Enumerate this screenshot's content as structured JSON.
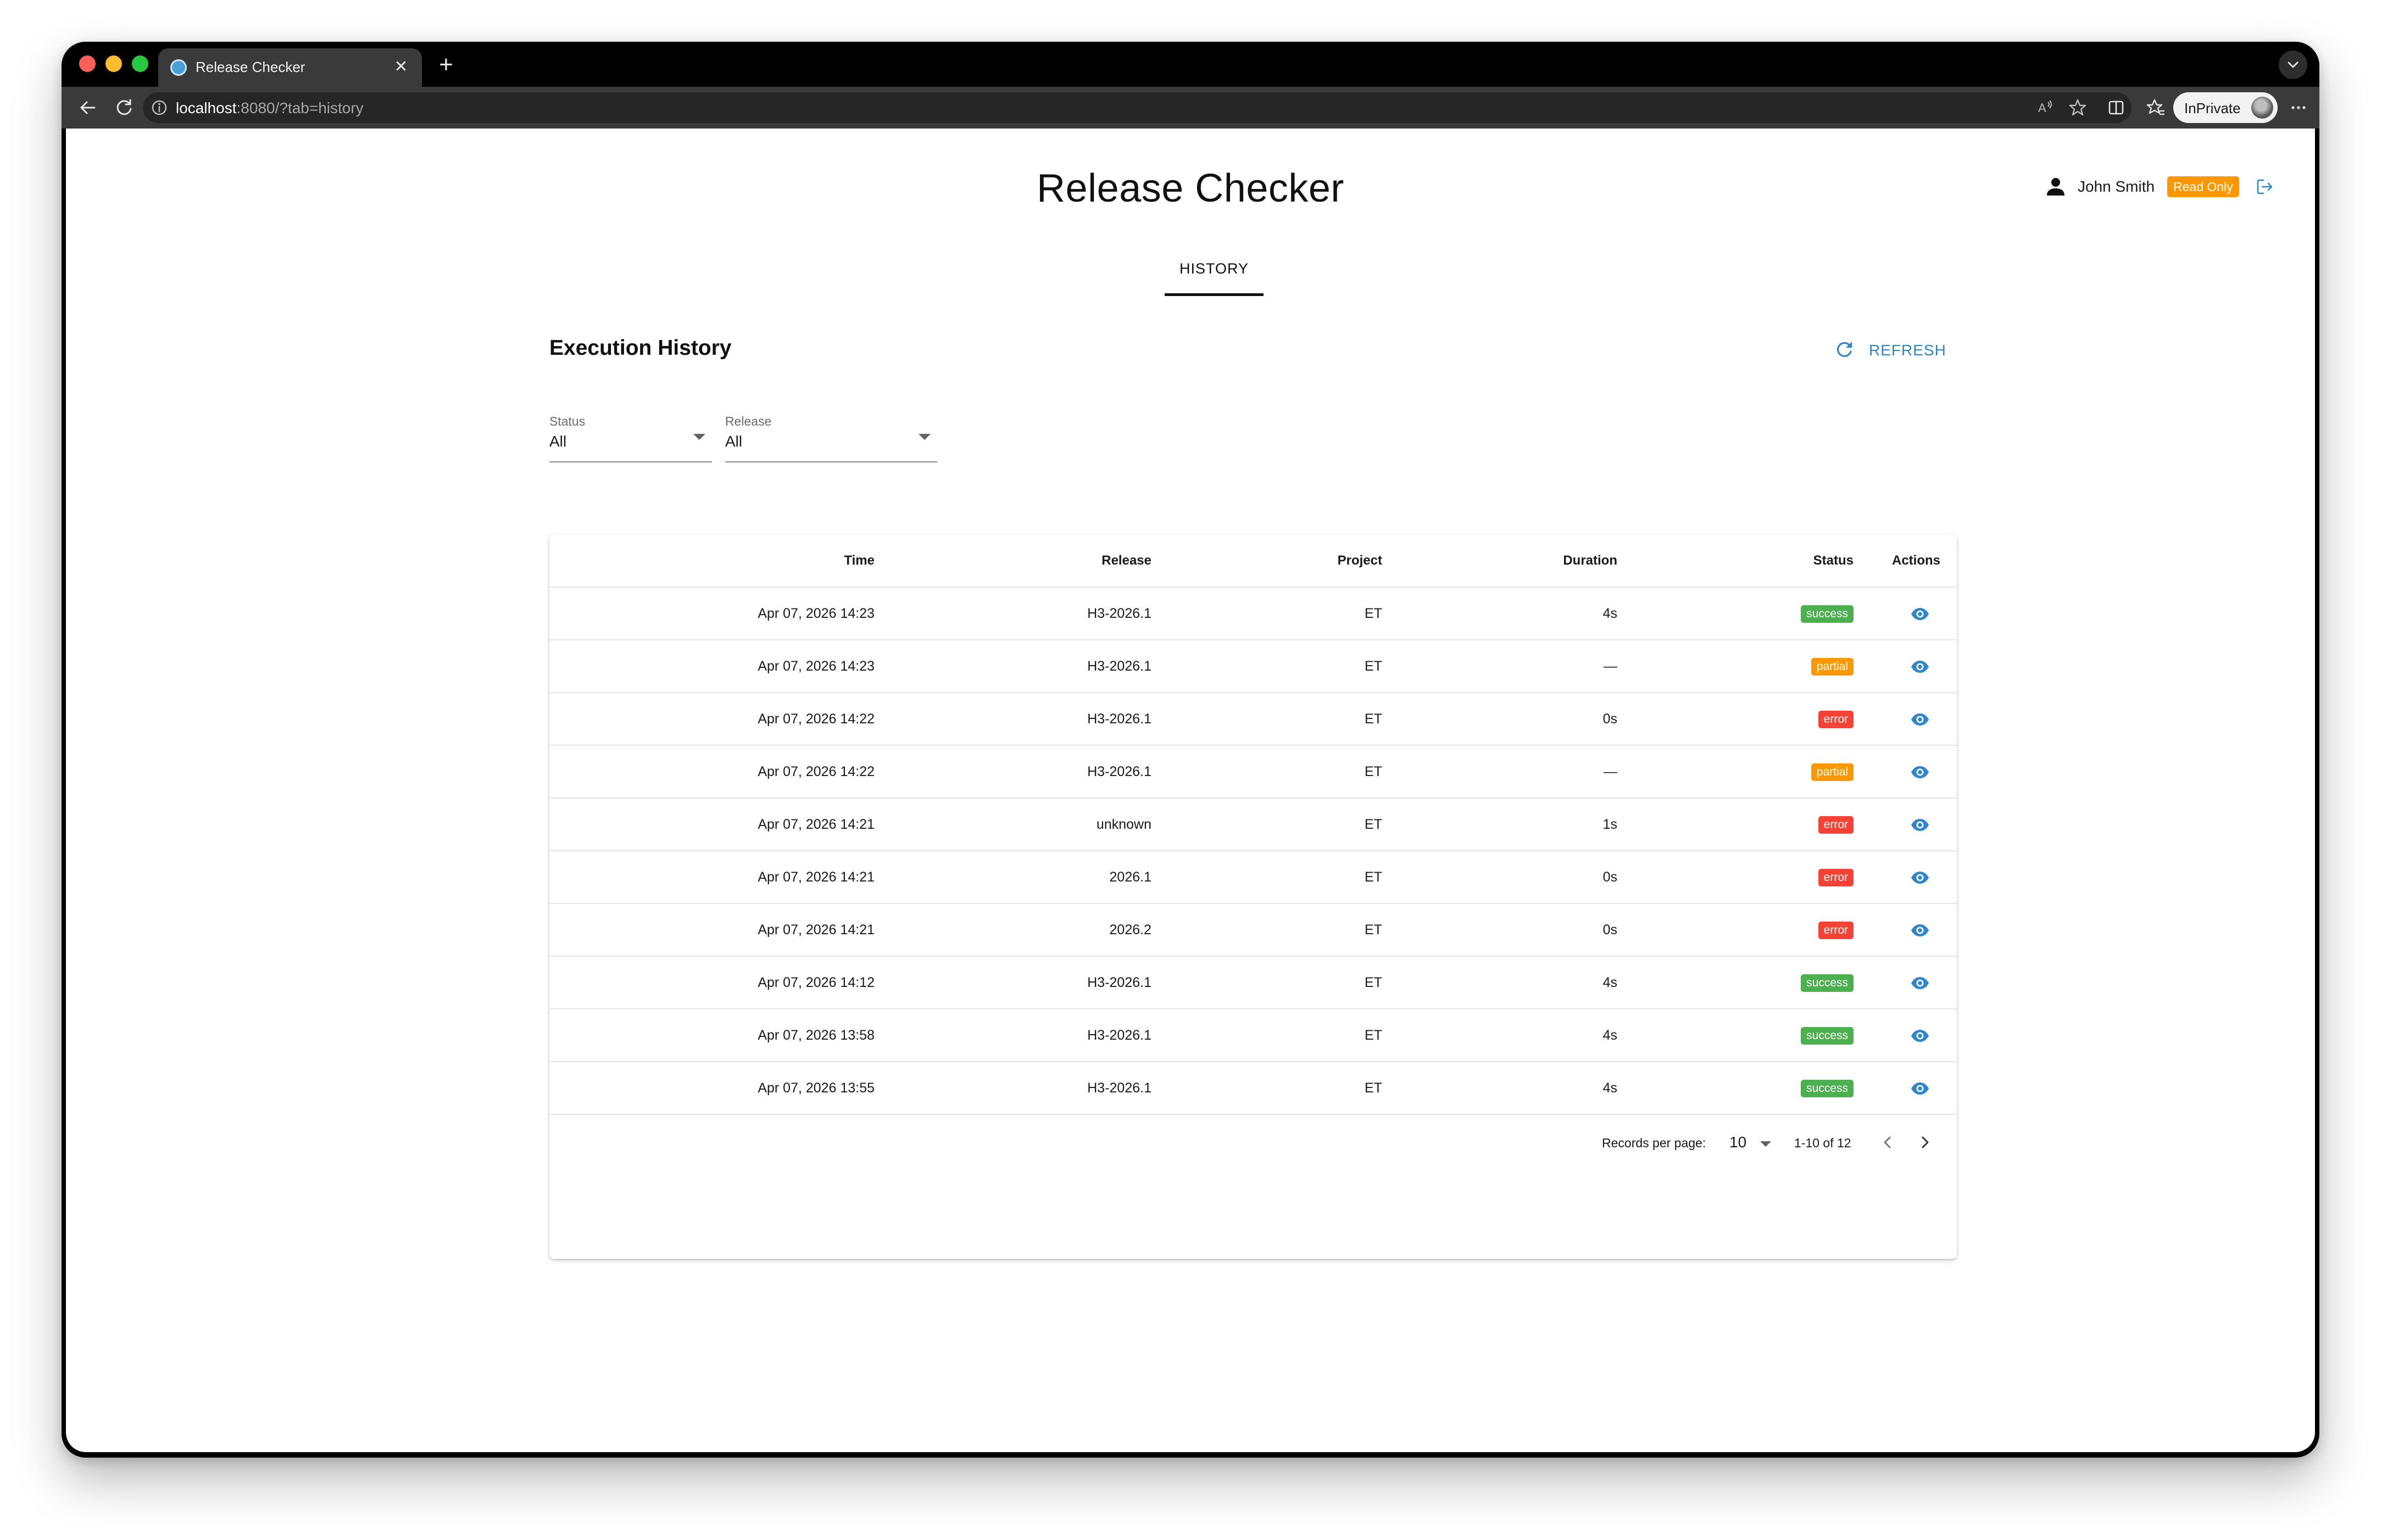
{
  "browser": {
    "tab_title": "Release Checker",
    "url_host": "localhost",
    "url_path": ":8080/?tab=history",
    "inprivate_label": "InPrivate"
  },
  "header": {
    "app_title": "Release Checker",
    "user_name": "John Smith",
    "role_badge": "Read Only",
    "role_badge_color": "#ff9800"
  },
  "tabs": [
    {
      "label": "HISTORY",
      "active": true
    }
  ],
  "section": {
    "title": "Execution History",
    "refresh_label": "REFRESH",
    "accent_color": "#2f86cc"
  },
  "filters": {
    "status": {
      "label": "Status",
      "value": "All"
    },
    "release": {
      "label": "Release",
      "value": "All"
    }
  },
  "table": {
    "columns": [
      "Time",
      "Release",
      "Project",
      "Duration",
      "Status",
      "Actions"
    ],
    "rows": [
      {
        "time": "Apr 07, 2026 14:23",
        "release": "H3-2026.1",
        "project": "ET",
        "duration": "4s",
        "status": "success"
      },
      {
        "time": "Apr 07, 2026 14:23",
        "release": "H3-2026.1",
        "project": "ET",
        "duration": "—",
        "status": "partial"
      },
      {
        "time": "Apr 07, 2026 14:22",
        "release": "H3-2026.1",
        "project": "ET",
        "duration": "0s",
        "status": "error"
      },
      {
        "time": "Apr 07, 2026 14:22",
        "release": "H3-2026.1",
        "project": "ET",
        "duration": "—",
        "status": "partial"
      },
      {
        "time": "Apr 07, 2026 14:21",
        "release": "unknown",
        "project": "ET",
        "duration": "1s",
        "status": "error"
      },
      {
        "time": "Apr 07, 2026 14:21",
        "release": "2026.1",
        "project": "ET",
        "duration": "0s",
        "status": "error"
      },
      {
        "time": "Apr 07, 2026 14:21",
        "release": "2026.2",
        "project": "ET",
        "duration": "0s",
        "status": "error"
      },
      {
        "time": "Apr 07, 2026 14:12",
        "release": "H3-2026.1",
        "project": "ET",
        "duration": "4s",
        "status": "success"
      },
      {
        "time": "Apr 07, 2026 13:58",
        "release": "H3-2026.1",
        "project": "ET",
        "duration": "4s",
        "status": "success"
      },
      {
        "time": "Apr 07, 2026 13:55",
        "release": "H3-2026.1",
        "project": "ET",
        "duration": "4s",
        "status": "success"
      }
    ],
    "action_icon": "eye-icon",
    "status_colors": {
      "success": "#4caf50",
      "partial": "#ff9800",
      "error": "#f44336"
    }
  },
  "pagination": {
    "records_per_page_label": "Records per page:",
    "records_per_page": "10",
    "range": "1-10 of 12"
  }
}
